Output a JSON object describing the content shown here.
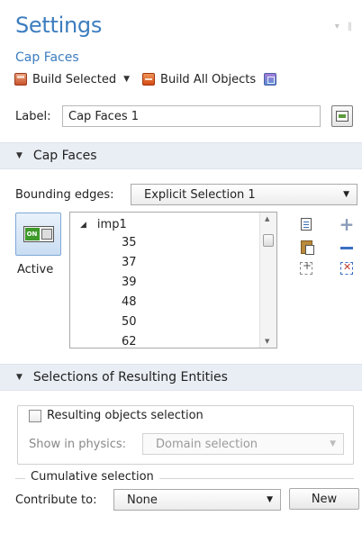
{
  "header": {
    "title": "Settings",
    "subtitle": "Cap Faces",
    "pin_controls": "▾ ‖"
  },
  "toolbar": {
    "build_selected_label": "Build Selected",
    "build_all_label": "Build All Objects"
  },
  "label_field": {
    "label": "Label:",
    "value": "Cap Faces 1"
  },
  "cap_faces_section": {
    "title": "Cap Faces",
    "bounding_edges_label": "Bounding edges:",
    "bounding_edges_value": "Explicit Selection 1",
    "active_toggle_text": "ON",
    "active_label": "Active",
    "tree_root": "imp1",
    "tree_items": [
      "35",
      "37",
      "39",
      "48",
      "50",
      "62"
    ]
  },
  "resulting_section": {
    "title": "Selections of Resulting Entities",
    "resulting_objects_label": "Resulting objects selection",
    "resulting_objects_checked": false,
    "show_in_physics_label": "Show in physics:",
    "show_in_physics_value": "Domain selection",
    "cumulative_label": "Cumulative selection",
    "contribute_label": "Contribute to:",
    "contribute_value": "None",
    "new_button": "New"
  },
  "colors": {
    "title_blue": "#3c7dbf",
    "section_bg": "#e9edf4",
    "toggle_green": "#3e9a2a"
  }
}
